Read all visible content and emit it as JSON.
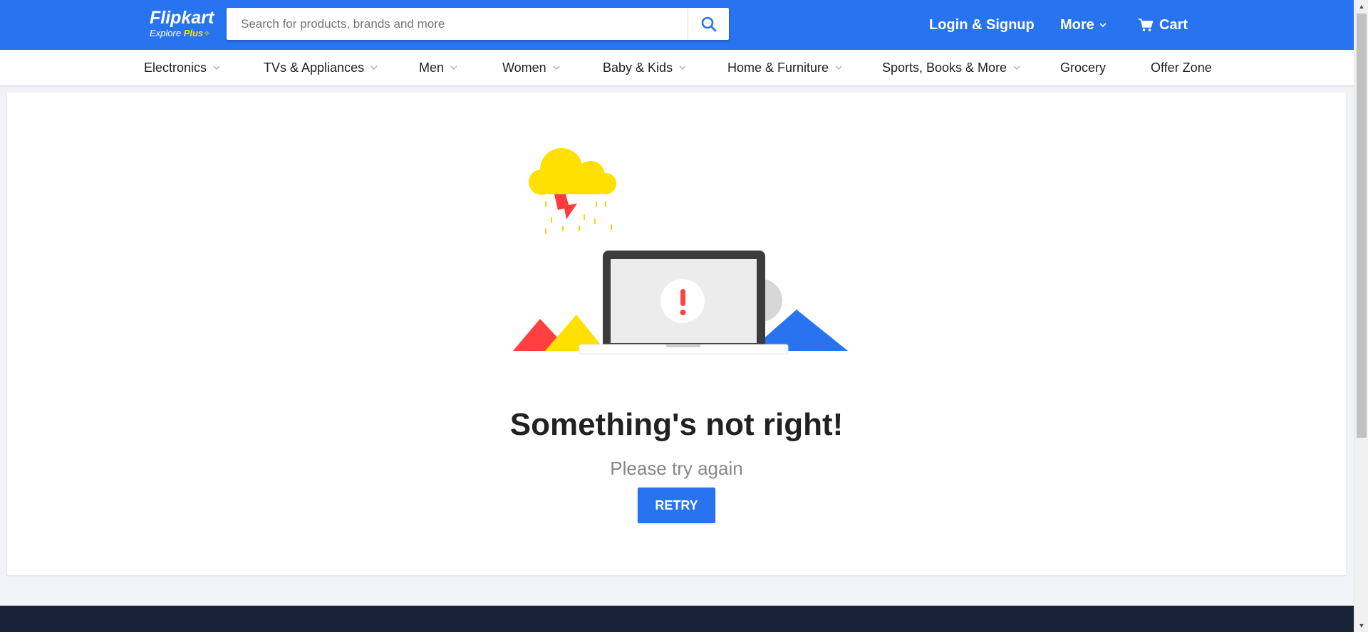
{
  "header": {
    "logo": {
      "brand": "Flipkart",
      "tagline_prefix": "Explore",
      "tagline_plus": "Plus"
    },
    "search": {
      "placeholder": "Search for products, brands and more",
      "value": ""
    },
    "login_label": "Login & Signup",
    "more_label": "More",
    "cart_label": "Cart",
    "colors": {
      "primary": "#2874f0",
      "accent": "#ffe500"
    }
  },
  "categories": [
    {
      "label": "Electronics",
      "dropdown": true
    },
    {
      "label": "TVs & Appliances",
      "dropdown": true
    },
    {
      "label": "Men",
      "dropdown": true
    },
    {
      "label": "Women",
      "dropdown": true
    },
    {
      "label": "Baby & Kids",
      "dropdown": true
    },
    {
      "label": "Home & Furniture",
      "dropdown": true
    },
    {
      "label": "Sports, Books & More",
      "dropdown": true
    },
    {
      "label": "Grocery",
      "dropdown": false
    },
    {
      "label": "Offer Zone",
      "dropdown": false
    }
  ],
  "error": {
    "title": "Something's not right!",
    "subtitle": "Please try again",
    "retry_label": "RETRY"
  }
}
